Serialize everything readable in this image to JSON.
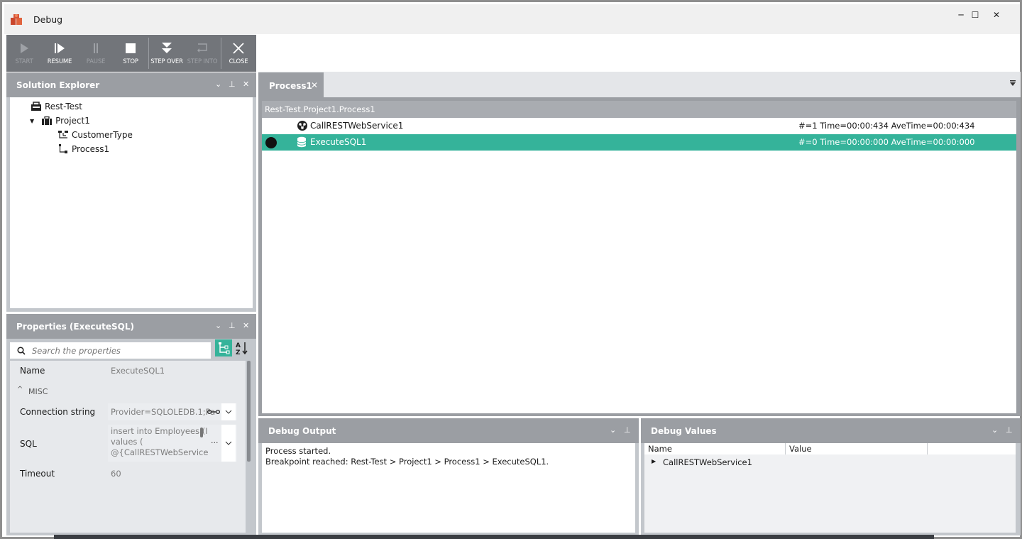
{
  "window": {
    "title": "Debug",
    "controls": {
      "minimize": "─",
      "maximize": "☐",
      "close": "✕"
    }
  },
  "toolbar": {
    "buttons": [
      {
        "label": "START",
        "icon": "play-icon",
        "enabled": false
      },
      {
        "label": "RESUME",
        "icon": "resume-icon",
        "enabled": true
      },
      {
        "label": "PAUSE",
        "icon": "pause-icon",
        "enabled": false
      },
      {
        "label": "STOP",
        "icon": "stop-icon",
        "enabled": true
      },
      {
        "label": "STEP OVER",
        "icon": "step-over-icon",
        "enabled": true
      },
      {
        "label": "STEP INTO",
        "icon": "step-into-icon",
        "enabled": false
      },
      {
        "label": "CLOSE",
        "icon": "close-icon",
        "enabled": true
      }
    ]
  },
  "solution_explorer": {
    "title": "Solution Explorer",
    "header_icons": {
      "dropdown": "⌄",
      "pin": "⊥",
      "close": "✕"
    },
    "tree": [
      {
        "label": "Rest-Test",
        "icon": "solution-icon"
      },
      {
        "label": "Project1",
        "icon": "project-icon",
        "expanded": true
      },
      {
        "label": "CustomerType",
        "icon": "type-icon"
      },
      {
        "label": "Process1",
        "icon": "process-icon"
      }
    ]
  },
  "properties": {
    "title": "Properties (ExecuteSQL)",
    "search_placeholder": "Search the properties",
    "rows": {
      "name": {
        "label": "Name",
        "value": "ExecuteSQL1"
      },
      "misc_category": "MISC",
      "connection": {
        "label": "Connection string",
        "value": "Provider=SQLOLEDB.1;Pa"
      },
      "sql": {
        "label": "SQL",
        "lines": [
          "insert into Employees (I",
          "values (",
          "@{CallRESTWebService"
        ],
        "ellipsis": "..."
      },
      "timeout": {
        "label": "Timeout",
        "value": "60"
      }
    }
  },
  "document": {
    "tab": {
      "label": "Process1",
      "close": "✕"
    },
    "breadcrumb": "Rest-Test.Project1.Process1",
    "rows": [
      {
        "name": "CallRESTWebService1",
        "stats": "#=1 Time=00:00:434 AveTime=00:00:434",
        "icon": "web-service-icon",
        "active": false,
        "breakpoint": false
      },
      {
        "name": "ExecuteSQL1",
        "stats": "#=0 Time=00:00:000 AveTime=00:00:000",
        "icon": "database-icon",
        "active": true,
        "breakpoint": true
      }
    ]
  },
  "debug_output": {
    "title": "Debug Output",
    "lines": [
      "Process started.",
      "Breakpoint reached: Rest-Test > Project1 > Process1 > ExecuteSQL1."
    ]
  },
  "debug_values": {
    "title": "Debug Values",
    "columns": [
      "Name",
      "Value"
    ],
    "rows": [
      {
        "name": "CallRESTWebService1"
      }
    ]
  },
  "colors": {
    "accent": "#35b39a",
    "toolbar": "#72757a",
    "panel_header": "#9b9ea3"
  }
}
